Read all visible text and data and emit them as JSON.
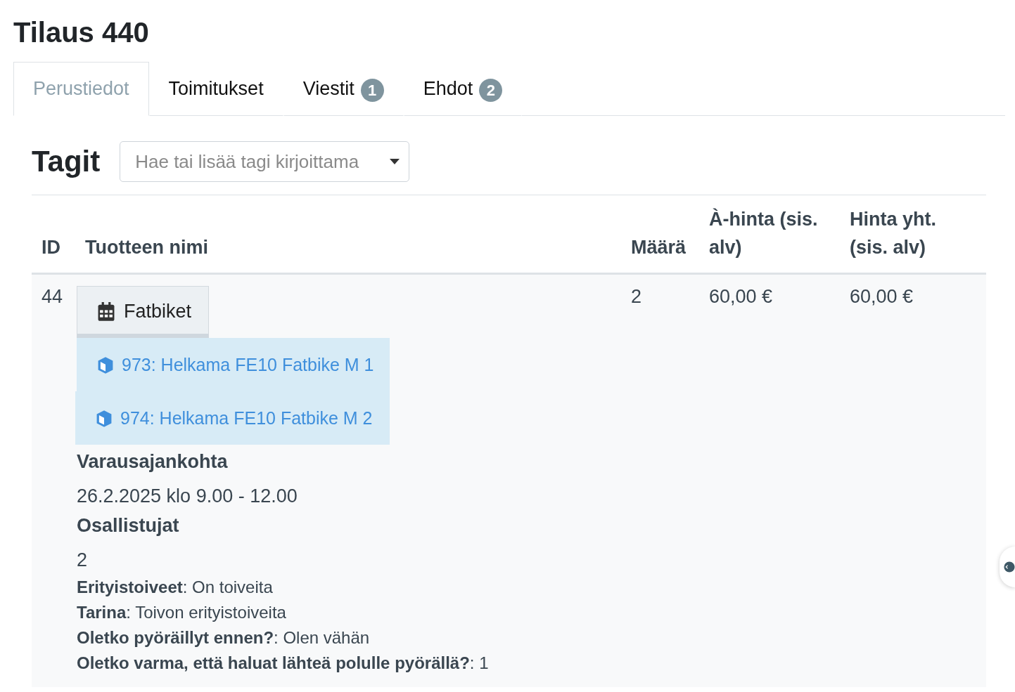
{
  "title": "Tilaus 440",
  "tabs": [
    {
      "label": "Perustiedot",
      "selected": true
    },
    {
      "label": "Toimitukset",
      "selected": false
    },
    {
      "label": "Viestit",
      "badge": "1",
      "selected": false
    },
    {
      "label": "Ehdot",
      "badge": "2",
      "selected": false
    }
  ],
  "tags": {
    "heading": "Tagit",
    "placeholder": "Hae tai lisää tagi kirjoittama"
  },
  "table": {
    "columns": [
      "ID",
      "Tuotteen nimi",
      "Määrä",
      "À-hinta (sis. alv)",
      "Hinta yht. (sis. alv)"
    ],
    "rows": [
      {
        "id": "44",
        "product": "Fatbiket",
        "items": [
          "973: Helkama FE10 Fatbike M 1",
          "974: Helkama FE10 Fatbike M 2"
        ],
        "details": [
          {
            "kind": "heading",
            "text": "Varausajankohta"
          },
          {
            "kind": "value",
            "text": "26.2.2025 klo 9.00 - 12.00"
          },
          {
            "kind": "heading",
            "text": "Osallistujat"
          },
          {
            "kind": "value",
            "text": "2"
          }
        ],
        "answers": [
          "**Erityistoiveet**: On toiveita",
          "**Tarina**: Toivon erityistoiveita",
          "**Oletko pyöräillyt ennen?**: Olen vähän",
          "**Oletko varma, että haluat lähteä polulle pyörällä?**: 1"
        ],
        "quantity": "2",
        "unit_price": "60,00 €",
        "total": "60,00 €"
      }
    ]
  }
}
